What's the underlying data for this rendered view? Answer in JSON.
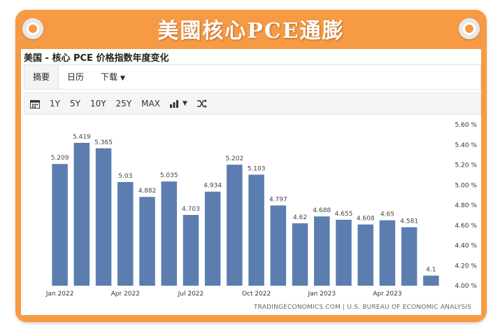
{
  "banner": {
    "title": "美國核心PCE通膨"
  },
  "chart_title": "美国 - 核心 PCE 价格指数年度变化",
  "tabs": [
    {
      "label": "摘要"
    },
    {
      "label": "日历"
    },
    {
      "label": "下载"
    }
  ],
  "toolbar": {
    "ranges": [
      "1Y",
      "5Y",
      "10Y",
      "25Y",
      "MAX"
    ],
    "icons": [
      "calendar-icon",
      "bar-chart-icon",
      "shuffle-icon"
    ]
  },
  "source": "TRADINGECONOMICS.COM | U.S. BUREAU OF ECONOMIC ANALYSIS",
  "colors": {
    "bar": "#5b7db0",
    "frame": "#f79a44"
  },
  "chart_data": {
    "type": "bar",
    "categories": [
      "2022-01",
      "2022-02",
      "2022-03",
      "2022-04",
      "2022-05",
      "2022-06",
      "2022-07",
      "2022-08",
      "2022-09",
      "2022-10",
      "2022-11",
      "2022-12",
      "2023-01",
      "2023-02",
      "2023-03",
      "2023-04",
      "2023-05",
      "2023-06"
    ],
    "values": [
      5.209,
      5.419,
      5.365,
      5.03,
      4.882,
      5.035,
      4.703,
      4.934,
      5.202,
      5.103,
      4.797,
      4.62,
      4.688,
      4.655,
      4.608,
      4.65,
      4.581,
      4.1
    ],
    "data_labels": [
      "5.209",
      "5.419",
      "5.365",
      "5.03",
      "4.882",
      "5.035",
      "4.703",
      "4.934",
      "5.202",
      "5.103",
      "4.797",
      "4.62",
      "4.688",
      "4.655",
      "4.608",
      "4.65",
      "4.581",
      "4.1"
    ],
    "x_tick_labels": [
      {
        "index": 0,
        "label": "Jan 2022"
      },
      {
        "index": 3,
        "label": "Apr 2022"
      },
      {
        "index": 6,
        "label": "Jul 2022"
      },
      {
        "index": 9,
        "label": "Oct 2022"
      },
      {
        "index": 12,
        "label": "Jan 2023"
      },
      {
        "index": 15,
        "label": "Apr 2023"
      }
    ],
    "y_ticks": [
      4.0,
      4.2,
      4.4,
      4.6,
      4.8,
      5.0,
      5.2,
      5.4,
      5.6
    ],
    "y_tick_labels": [
      "4.00 %",
      "4.20 %",
      "4.40 %",
      "4.60 %",
      "4.80 %",
      "5.00 %",
      "5.20 %",
      "5.40 %",
      "5.60 %"
    ],
    "ylim": [
      4.0,
      5.6
    ],
    "y_axis_side": "right",
    "grid": false
  }
}
